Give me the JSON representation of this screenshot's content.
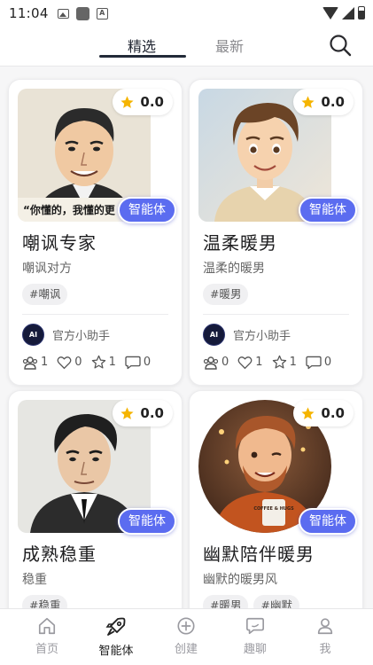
{
  "status_bar": {
    "time": "11:04"
  },
  "tabs": [
    {
      "label": "精选",
      "active": true
    },
    {
      "label": "最新",
      "active": false
    }
  ],
  "cards": [
    {
      "title": "嘲讽专家",
      "subtitle": "嘲讽对方",
      "rating": "0.0",
      "badge": "智能体",
      "image_caption": "“你懂的，我懂的更",
      "tags": [
        "#嘲讽"
      ],
      "author": "官方小助手",
      "stats": {
        "users": "1",
        "likes": "0",
        "favorites": "1",
        "comments": "0"
      }
    },
    {
      "title": "温柔暖男",
      "subtitle": "温柔的暖男",
      "rating": "0.0",
      "badge": "智能体",
      "tags": [
        "#暖男"
      ],
      "author": "官方小助手",
      "stats": {
        "users": "0",
        "likes": "1",
        "favorites": "1",
        "comments": "0"
      }
    },
    {
      "title": "成熟稳重",
      "subtitle": "稳重",
      "rating": "0.0",
      "badge": "智能体",
      "tags": [
        "#稳重"
      ]
    },
    {
      "title": "幽默陪伴暖男",
      "subtitle": "幽默的暖男风",
      "rating": "0.0",
      "badge": "智能体",
      "image_caption": "COFFEE & HUGS",
      "tags": [
        "#暖男",
        "#幽默"
      ]
    }
  ],
  "avatar_text": "AI",
  "bottom_nav": [
    {
      "label": "首页",
      "icon": "home-icon",
      "active": false
    },
    {
      "label": "智能体",
      "icon": "rocket-icon",
      "active": true
    },
    {
      "label": "创建",
      "icon": "plus-circle-icon",
      "active": false
    },
    {
      "label": "趣聊",
      "icon": "chat-icon",
      "active": false
    },
    {
      "label": "我",
      "icon": "user-icon",
      "active": false
    }
  ],
  "colors": {
    "accent": "#5b6cf0",
    "star": "#f5b400",
    "tab_underline": "#222a38"
  }
}
